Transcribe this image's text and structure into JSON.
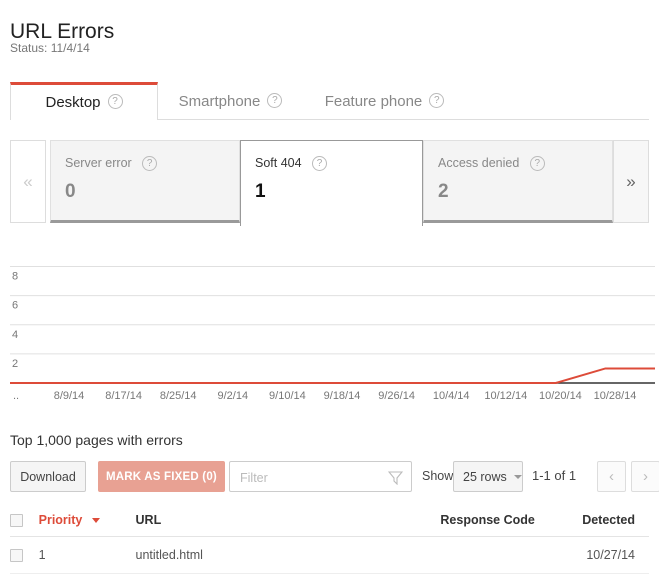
{
  "header": {
    "title": "URL Errors",
    "status_label": "Status:",
    "status_date": "11/4/14",
    "status_full": "Status: 11/4/14"
  },
  "tabs": [
    {
      "label": "Desktop",
      "help": "?",
      "active": true
    },
    {
      "label": "Smartphone",
      "help": "?",
      "active": false
    },
    {
      "label": "Feature phone",
      "help": "?",
      "active": false
    }
  ],
  "tiles": {
    "prev_arrow": "«",
    "next_arrow": "»",
    "items": [
      {
        "label": "Server error",
        "help": "?",
        "count": "0",
        "active": false
      },
      {
        "label": "Soft 404",
        "help": "?",
        "count": "1",
        "active": true
      },
      {
        "label": "Access denied",
        "help": "?",
        "count": "2",
        "active": false
      }
    ]
  },
  "chart_data": {
    "type": "line",
    "title": "",
    "xlabel": "",
    "ylabel": "",
    "ylim": [
      0,
      9
    ],
    "yticks": [
      2,
      4,
      6,
      8
    ],
    "grid": true,
    "legend": "none",
    "line_color": "#dd4b39",
    "axis_color": "#333333",
    "leading_tick_label": "..",
    "xtick_labels": [
      "8/9/14",
      "8/17/14",
      "8/25/14",
      "9/2/14",
      "9/10/14",
      "9/18/14",
      "9/26/14",
      "10/4/14",
      "10/12/14",
      "10/20/14",
      "10/28/14"
    ],
    "x": [
      "8/1/14",
      "8/9/14",
      "8/17/14",
      "8/25/14",
      "9/2/14",
      "9/10/14",
      "9/18/14",
      "9/26/14",
      "10/4/14",
      "10/12/14",
      "10/20/14",
      "10/25/14",
      "10/27/14",
      "11/4/14"
    ],
    "series": [
      {
        "name": "Soft 404 errors",
        "values": [
          0,
          0,
          0,
          0,
          0,
          0,
          0,
          0,
          0,
          0,
          0,
          0,
          1,
          1
        ]
      }
    ]
  },
  "table_section": {
    "heading": "Top 1,000 pages with errors",
    "toolbar": {
      "download_label": "Download",
      "mark_fixed_label": "MARK AS FIXED (0)",
      "filter_placeholder": "Filter",
      "filter_value": "",
      "show_label": "Show",
      "rows_value": "25 rows",
      "range_label": "1-1 of 1",
      "pager_prev": "‹",
      "pager_next": "›"
    },
    "columns": [
      {
        "key": "check",
        "label": ""
      },
      {
        "key": "priority",
        "label": "Priority",
        "sorted": true
      },
      {
        "key": "url",
        "label": "URL"
      },
      {
        "key": "response",
        "label": "Response Code"
      },
      {
        "key": "detected",
        "label": "Detected"
      }
    ],
    "rows": [
      {
        "priority": "1",
        "url": "untitled.html",
        "response": "",
        "detected": "10/27/14"
      }
    ]
  }
}
